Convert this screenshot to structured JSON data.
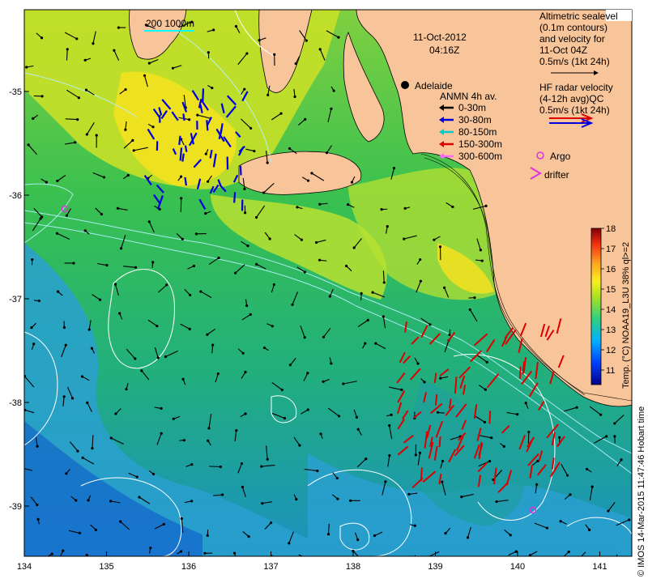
{
  "map": {
    "date": "11-Oct-2012",
    "time": "04:16Z",
    "scale_bar_label": "200 1000m",
    "place": "Adelaide",
    "x_ticks": [
      "134",
      "135",
      "136",
      "137",
      "138",
      "139",
      "140",
      "141"
    ],
    "y_ticks": [
      "-35",
      "-36",
      "-37",
      "-38",
      "-39"
    ],
    "legend_altimetry": [
      "Altimetric sealevel",
      "(0.1m contours)",
      "and velocity for",
      "11-Oct 04Z",
      "0.5m/s (1kt 24h)"
    ],
    "legend_radar": [
      "HF radar velocity",
      "(4-12h avg)QC",
      "0.5m/s (1kt 24h)"
    ],
    "legend_anmn_title": "ANMN 4h av.",
    "legend_anmn": [
      {
        "label": "0-30m",
        "color": "#000000"
      },
      {
        "label": "30-80m",
        "color": "#0000dd"
      },
      {
        "label": "80-150m",
        "color": "#00cccc"
      },
      {
        "label": "150-300m",
        "color": "#dd0000"
      },
      {
        "label": "300-600m",
        "color": "#ff66ff"
      }
    ],
    "legend_argo": "Argo",
    "legend_drifter": "drifter",
    "colorbar_title": "Temp. (°C) NOAA19_L3U 38% ql>=2",
    "colorbar_ticks": [
      "11",
      "12",
      "13",
      "14",
      "15",
      "16",
      "17",
      "18"
    ],
    "credit": "© IMOS 14-Mar-2015 11:47:46 Hobart time",
    "colors": {
      "land": "#f8c49a",
      "sea_cool": "#1bb05a",
      "sea_warm": "#e9e020",
      "radar": "#dd0000",
      "anmn_blue": "#0000dd",
      "argo": "#dd33dd"
    }
  }
}
